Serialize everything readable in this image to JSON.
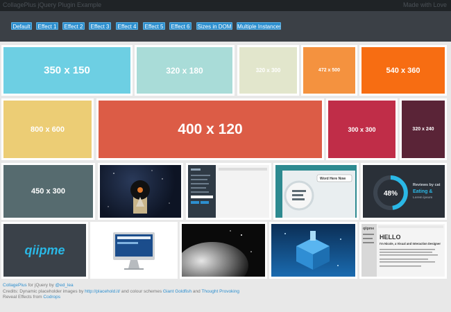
{
  "header": {
    "title": "CollagePlus jQuery Plugin Example",
    "right_link": "Made with Love"
  },
  "buttons": [
    "Default",
    "Effect 1",
    "Effect 2",
    "Effect 3",
    "Effect 4",
    "Effect 5",
    "Effect 6",
    "Sizes in DOM",
    "Multiple Instances"
  ],
  "tiles": {
    "t1": {
      "label": "350 x 150",
      "color": "#6dcfe3"
    },
    "t2": {
      "label": "320 x 180",
      "color": "#a9dcd8"
    },
    "t3": {
      "label": "320 x 300",
      "color": "#e2e6cc"
    },
    "t4": {
      "label": "472 x 500",
      "color": "#f4923f"
    },
    "t5": {
      "label": "540 x 360",
      "color": "#f76d12"
    },
    "t6": {
      "label": "800 x 600",
      "color": "#eccd75"
    },
    "t7": {
      "label": "400 x 120",
      "color": "#dc5c46"
    },
    "t8": {
      "label": "300 x 300",
      "color": "#c02d48"
    },
    "t9": {
      "label": "320 x 240",
      "color": "#5a2437"
    },
    "t10": {
      "label": "450 x 300",
      "color": "#566b6f"
    },
    "dial": {
      "value": "48%",
      "text1": "Reviews by cat",
      "text2": "Eating &",
      "text3": "Lorem ipsum"
    },
    "logo": {
      "text": "qiipme"
    },
    "page": {
      "heading": "HELLO",
      "subheading": "I'm Nicole, a Visual and Interaction Designer",
      "tab1": "Word Here Now",
      "tab2": "qiipme"
    }
  },
  "footer": {
    "line1_link": "CollagePlus",
    "line1_text": " for jQuery by ",
    "line1_author": "@ed_lea",
    "line2_text": "Credits: Dynamic placeholder images by ",
    "line2_link1": "http://placehold.it/",
    "line2_text2": " and colour schemes ",
    "line2_link2": "Giant Goldfish",
    "line2_text3": " and ",
    "line2_link3": "Thought Provoking",
    "line3_text": "Reveal Effects from ",
    "line3_link": "Codrops"
  }
}
